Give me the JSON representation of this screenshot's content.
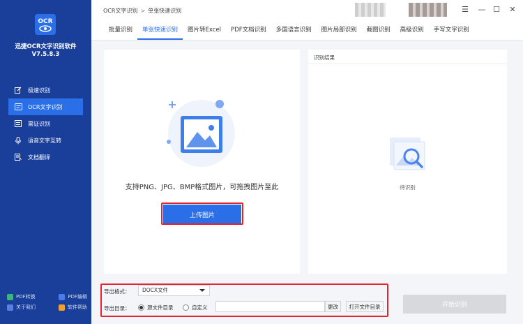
{
  "app": {
    "name": "迅捷OCR文字识别软件",
    "version": "V7.5.8.3",
    "logo_text": "OCR"
  },
  "sidebar": {
    "items": [
      {
        "label": "极速识别",
        "icon": "edit-icon",
        "active": false
      },
      {
        "label": "OCR文字识别",
        "icon": "ocr-icon",
        "active": true
      },
      {
        "label": "票证识别",
        "icon": "ticket-icon",
        "active": false
      },
      {
        "label": "语音文字互转",
        "icon": "microphone-icon",
        "active": false
      },
      {
        "label": "文档翻译",
        "icon": "document-translate-icon",
        "active": false
      }
    ],
    "footer": [
      {
        "label": "PDF转换",
        "color": "#3fb37f"
      },
      {
        "label": "PDF编辑",
        "color": "#4a7be8"
      },
      {
        "label": "关于我们",
        "color": "#5b7fe0"
      },
      {
        "label": "软件帮助",
        "color": "#f0a030"
      }
    ]
  },
  "breadcrumb": {
    "parent": "OCR文字识别",
    "current": "单张快速识别"
  },
  "window_controls": {
    "menu": "☰",
    "minimize": "—",
    "maximize": "☐",
    "close": "✕"
  },
  "tabs": [
    {
      "label": "批量识别",
      "active": false
    },
    {
      "label": "单张快速识别",
      "active": true
    },
    {
      "label": "图片转Excel",
      "active": false
    },
    {
      "label": "PDF文档识别",
      "active": false
    },
    {
      "label": "多国语言识别",
      "active": false
    },
    {
      "label": "图片局部识别",
      "active": false
    },
    {
      "label": "截图识别",
      "active": false
    },
    {
      "label": "高级识别",
      "active": false
    },
    {
      "label": "手写文字识别",
      "active": false
    }
  ],
  "upload": {
    "hint": "支持PNG、JPG、BMP格式图片，可拖拽图片至此",
    "button": "上传图片"
  },
  "result": {
    "title": "识别结果",
    "placeholder": "待识别"
  },
  "export": {
    "format_label": "导出格式：",
    "format_value": "DOCX文件",
    "dir_label": "导出目录：",
    "option_source": "源文件目录",
    "option_custom": "自定义",
    "path_value": "",
    "change_button": "更改",
    "open_dir_button": "打开文件目录"
  },
  "start_button": "开始识别",
  "colors": {
    "sidebar_bg": "#1a3f9a",
    "accent": "#2b6fe8",
    "highlight_box": "#e3262d",
    "disabled_button": "#d7d9dd"
  }
}
